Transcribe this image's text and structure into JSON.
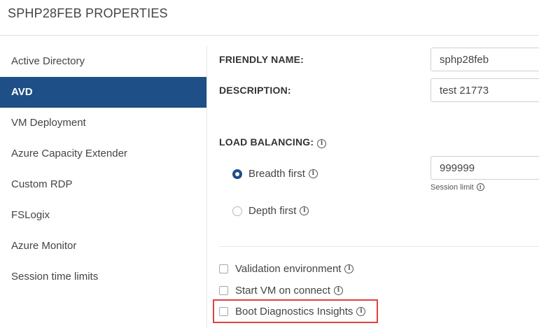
{
  "header": {
    "title": "SPHP28FEB PROPERTIES"
  },
  "sidebar": {
    "items": [
      {
        "label": "Active Directory"
      },
      {
        "label": "AVD",
        "active": true
      },
      {
        "label": "VM Deployment"
      },
      {
        "label": "Azure Capacity Extender"
      },
      {
        "label": "Custom RDP"
      },
      {
        "label": "FSLogix"
      },
      {
        "label": "Azure Monitor"
      },
      {
        "label": "Session time limits"
      }
    ]
  },
  "form": {
    "friendly_name_label": "FRIENDLY NAME:",
    "friendly_name_value": "sphp28feb",
    "description_label": "DESCRIPTION:",
    "description_value": "test 21773",
    "load_balancing_label": "LOAD BALANCING:",
    "breadth_first_label": "Breadth first",
    "depth_first_label": "Depth first",
    "selected_load_balancing": "Breadth first",
    "session_limit_value": "999999",
    "session_limit_label": "Session limit",
    "validation_env_label": "Validation environment",
    "start_vm_label": "Start VM on connect",
    "boot_diag_label": "Boot Diagnostics Insights"
  },
  "icons": {
    "info": "info-circle-icon"
  },
  "colors": {
    "accent": "#1e4f86",
    "highlight": "#e0403f"
  }
}
